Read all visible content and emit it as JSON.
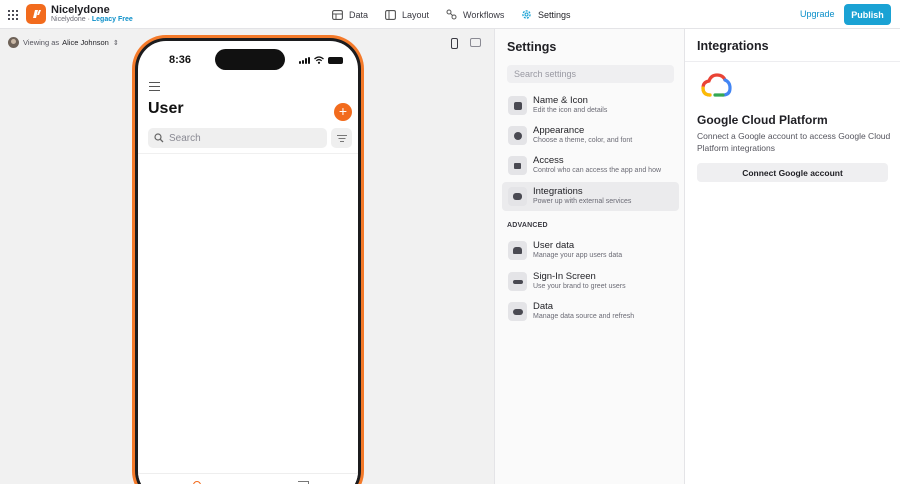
{
  "app": {
    "name": "Nicelydone",
    "org": "Nicelydone",
    "separator": "·",
    "plan": "Legacy Free"
  },
  "nav": {
    "data": "Data",
    "layout": "Layout",
    "workflows": "Workflows",
    "settings": "Settings"
  },
  "header_actions": {
    "upgrade": "Upgrade",
    "publish": "Publish"
  },
  "colors": {
    "brand": "#f26b1d",
    "accent": "#1aa2d4",
    "active_nav": "#0b8fc9"
  },
  "viewing": {
    "prefix": "Viewing as",
    "user": "Alice Johnson"
  },
  "phone": {
    "time": "8:36",
    "screen_title": "User",
    "add_button": "+",
    "search_placeholder": "Search"
  },
  "settings": {
    "title": "Settings",
    "search_placeholder": "Search settings",
    "items": [
      {
        "title": "Name & Icon",
        "desc": "Edit the icon and details",
        "icon": "app-icon"
      },
      {
        "title": "Appearance",
        "desc": "Choose a theme, color, and font",
        "icon": "palette-icon"
      },
      {
        "title": "Access",
        "desc": "Control who can access the app and how",
        "icon": "lock-icon"
      },
      {
        "title": "Integrations",
        "desc": "Power up with external services",
        "icon": "integrations-icon",
        "active": true
      }
    ],
    "advanced_label": "ADVANCED",
    "advanced_items": [
      {
        "title": "User data",
        "desc": "Manage your app users data",
        "icon": "users-icon"
      },
      {
        "title": "Sign-In Screen",
        "desc": "Use your brand to greet users",
        "icon": "key-icon"
      },
      {
        "title": "Data",
        "desc": "Manage data source and refresh",
        "icon": "cloud-icon"
      }
    ]
  },
  "integrations": {
    "title": "Integrations",
    "provider": "Google Cloud Platform",
    "description": "Connect a Google account to access Google Cloud Platform integrations",
    "connect_button": "Connect Google account"
  }
}
